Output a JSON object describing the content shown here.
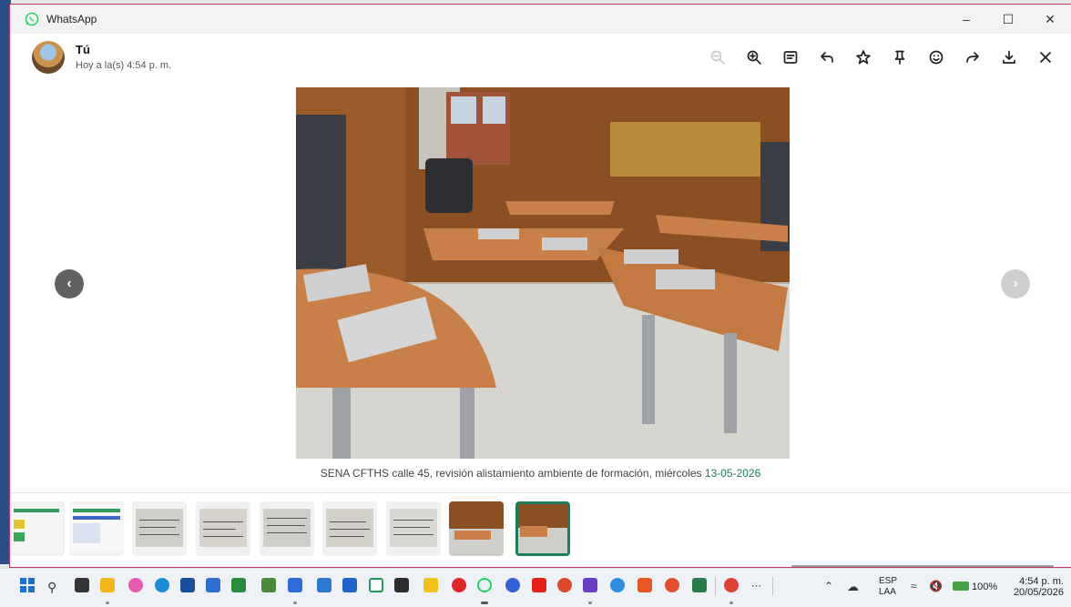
{
  "window": {
    "app_title": "WhatsApp"
  },
  "header": {
    "sender": "Tú",
    "timestamp": "Hoy a la(s) 4:54 p. m."
  },
  "caption": {
    "text": "SENA CFTHS calle 45, revisión alistamiento ambiente de formación, miércoles ",
    "date": "13-05-2026"
  },
  "taskbar": {
    "language_top": "ESP",
    "language_bottom": "LAA",
    "battery": "100%",
    "clock_time": "4:54 p. m.",
    "clock_date": "20/05/2026"
  },
  "colors": {
    "accent": "#1b7f5b",
    "brand": "#25d366",
    "window_border": "#c6335e"
  },
  "icons": [
    "zoom-out-icon",
    "zoom-in-icon",
    "message-icon",
    "reply-icon",
    "star-icon",
    "pin-icon",
    "emoji-icon",
    "forward-icon",
    "download-icon",
    "close-icon"
  ]
}
